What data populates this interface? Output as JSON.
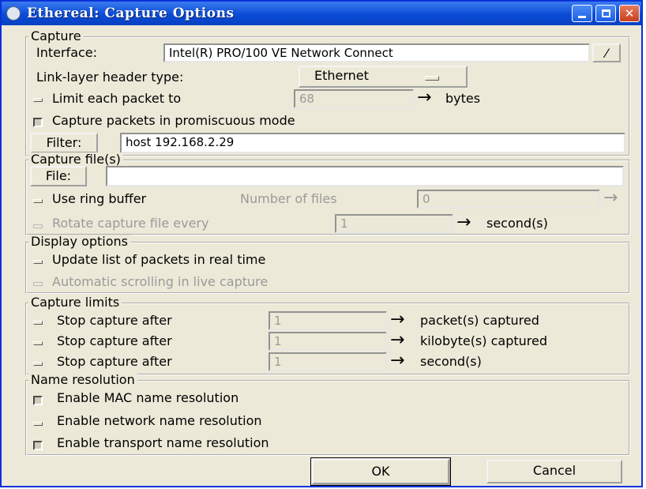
{
  "window": {
    "title": "Ethereal: Capture Options"
  },
  "capture": {
    "legend": "Capture",
    "interface_label": "Interface:",
    "interface_value": "Intel(R) PRO/100 VE Network Connect",
    "linklayer_label": "Link-layer header type:",
    "linklayer_value": "Ethernet",
    "limit_label": "Limit each packet to",
    "limit_value": "68",
    "limit_unit": "bytes",
    "promisc_label": "Capture packets in promiscuous mode",
    "filter_button": "Filter:",
    "filter_value": "host 192.168.2.29"
  },
  "capture_files": {
    "legend": "Capture file(s)",
    "file_button": "File:",
    "file_value": "",
    "ring_label": "Use ring buffer",
    "numfiles_label": "Number of files",
    "numfiles_value": "0",
    "rotate_label": "Rotate capture file every",
    "rotate_value": "1",
    "rotate_unit": "second(s)"
  },
  "display": {
    "legend": "Display options",
    "update_label": "Update list of packets in real time",
    "autoscroll_label": "Automatic scrolling in live capture"
  },
  "limits": {
    "legend": "Capture limits",
    "rows": [
      {
        "label": "Stop capture after",
        "value": "1",
        "unit": "packet(s) captured"
      },
      {
        "label": "Stop capture after",
        "value": "1",
        "unit": "kilobyte(s) captured"
      },
      {
        "label": "Stop capture after",
        "value": "1",
        "unit": "second(s)"
      }
    ]
  },
  "names": {
    "legend": "Name resolution",
    "mac_label": "Enable MAC name resolution",
    "network_label": "Enable network name resolution",
    "transport_label": "Enable transport name resolution"
  },
  "buttons": {
    "ok": "OK",
    "cancel": "Cancel"
  },
  "colors": {
    "titlebar": "#0a4bd6",
    "dialog_bg": "#ece9d8"
  }
}
